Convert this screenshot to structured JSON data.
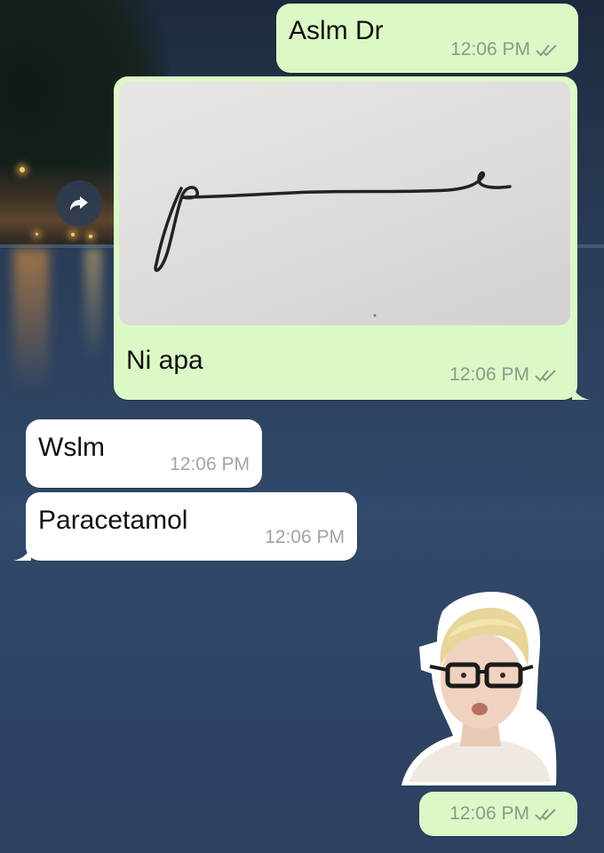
{
  "messages": [
    {
      "direction": "outgoing",
      "text": "Aslm Dr",
      "time": "12:06 PM",
      "status": "read"
    },
    {
      "direction": "outgoing",
      "type": "image",
      "caption": "Ni apa",
      "time": "12:06 PM",
      "status": "read"
    },
    {
      "direction": "incoming",
      "text": "Wslm",
      "time": "12:06 PM"
    },
    {
      "direction": "incoming",
      "text": "Paracetamol",
      "time": "12:06 PM"
    },
    {
      "direction": "outgoing",
      "type": "sticker",
      "time": "12:06 PM",
      "status": "read"
    }
  ],
  "icons": {
    "forward": "forward-arrow-icon",
    "read_receipt": "double-check-icon"
  },
  "colors": {
    "outgoing_bubble": "#dcf8c6",
    "incoming_bubble": "#ffffff",
    "read_tick": "#8b9a8a"
  }
}
